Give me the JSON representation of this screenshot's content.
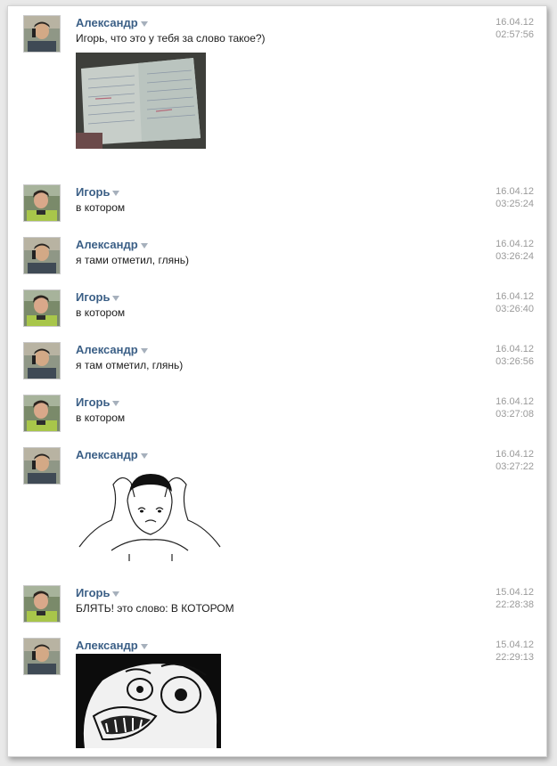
{
  "messages": [
    {
      "author": "Александр",
      "text": "Игорь, что это у тебя за слово такое?)",
      "date": "16.04.12",
      "time": "02:57:56",
      "attachment": "notebook-photo"
    },
    {
      "author": "Игорь",
      "text": "в котором",
      "date": "16.04.12",
      "time": "03:25:24"
    },
    {
      "author": "Александр",
      "text": "я тами отметил, глянь)",
      "date": "16.04.12",
      "time": "03:26:24"
    },
    {
      "author": "Игорь",
      "text": "в котором",
      "date": "16.04.12",
      "time": "03:26:40"
    },
    {
      "author": "Александр",
      "text": "я там отметил, глянь)",
      "date": "16.04.12",
      "time": "03:26:56"
    },
    {
      "author": "Игорь",
      "text": "в котором",
      "date": "16.04.12",
      "time": "03:27:08"
    },
    {
      "author": "Александр",
      "text": "",
      "date": "16.04.12",
      "time": "03:27:22",
      "attachment": "jackie-chan-meme"
    },
    {
      "author": "Игорь",
      "text": "БЛЯТЬ! это слово: В КОТОРОМ",
      "date": "15.04.12",
      "time": "22:28:38"
    },
    {
      "author": "Александр",
      "text": "",
      "date": "15.04.12",
      "time": "22:29:13",
      "attachment": "raging-face-meme"
    }
  ],
  "colors": {
    "author": "#3b5f86",
    "timestamp": "#9a9a9a",
    "text": "#1b1b1b"
  },
  "icons": {
    "author_menu": "caret-down-icon"
  }
}
